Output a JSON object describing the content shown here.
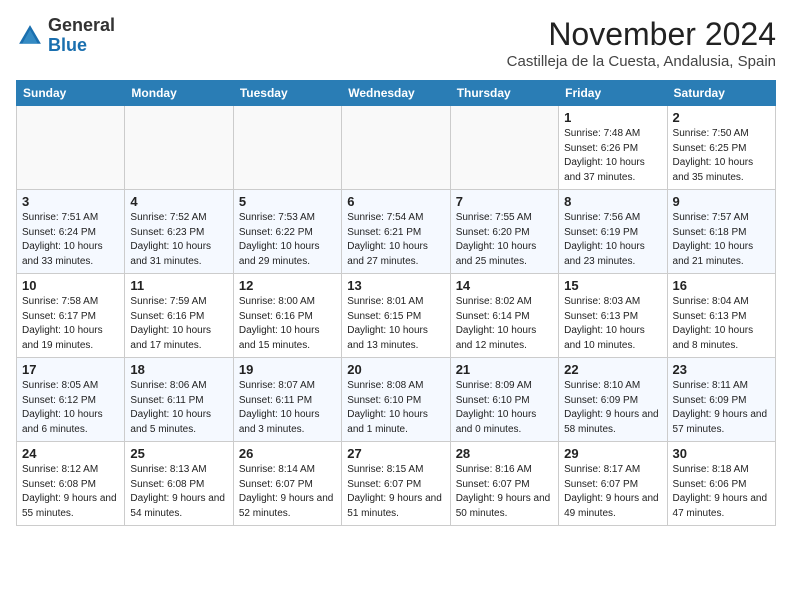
{
  "header": {
    "logo_general": "General",
    "logo_blue": "Blue",
    "month_year": "November 2024",
    "location": "Castilleja de la Cuesta, Andalusia, Spain"
  },
  "weekdays": [
    "Sunday",
    "Monday",
    "Tuesday",
    "Wednesday",
    "Thursday",
    "Friday",
    "Saturday"
  ],
  "weeks": [
    [
      {
        "day": "",
        "info": ""
      },
      {
        "day": "",
        "info": ""
      },
      {
        "day": "",
        "info": ""
      },
      {
        "day": "",
        "info": ""
      },
      {
        "day": "",
        "info": ""
      },
      {
        "day": "1",
        "info": "Sunrise: 7:48 AM\nSunset: 6:26 PM\nDaylight: 10 hours and 37 minutes."
      },
      {
        "day": "2",
        "info": "Sunrise: 7:50 AM\nSunset: 6:25 PM\nDaylight: 10 hours and 35 minutes."
      }
    ],
    [
      {
        "day": "3",
        "info": "Sunrise: 7:51 AM\nSunset: 6:24 PM\nDaylight: 10 hours and 33 minutes."
      },
      {
        "day": "4",
        "info": "Sunrise: 7:52 AM\nSunset: 6:23 PM\nDaylight: 10 hours and 31 minutes."
      },
      {
        "day": "5",
        "info": "Sunrise: 7:53 AM\nSunset: 6:22 PM\nDaylight: 10 hours and 29 minutes."
      },
      {
        "day": "6",
        "info": "Sunrise: 7:54 AM\nSunset: 6:21 PM\nDaylight: 10 hours and 27 minutes."
      },
      {
        "day": "7",
        "info": "Sunrise: 7:55 AM\nSunset: 6:20 PM\nDaylight: 10 hours and 25 minutes."
      },
      {
        "day": "8",
        "info": "Sunrise: 7:56 AM\nSunset: 6:19 PM\nDaylight: 10 hours and 23 minutes."
      },
      {
        "day": "9",
        "info": "Sunrise: 7:57 AM\nSunset: 6:18 PM\nDaylight: 10 hours and 21 minutes."
      }
    ],
    [
      {
        "day": "10",
        "info": "Sunrise: 7:58 AM\nSunset: 6:17 PM\nDaylight: 10 hours and 19 minutes."
      },
      {
        "day": "11",
        "info": "Sunrise: 7:59 AM\nSunset: 6:16 PM\nDaylight: 10 hours and 17 minutes."
      },
      {
        "day": "12",
        "info": "Sunrise: 8:00 AM\nSunset: 6:16 PM\nDaylight: 10 hours and 15 minutes."
      },
      {
        "day": "13",
        "info": "Sunrise: 8:01 AM\nSunset: 6:15 PM\nDaylight: 10 hours and 13 minutes."
      },
      {
        "day": "14",
        "info": "Sunrise: 8:02 AM\nSunset: 6:14 PM\nDaylight: 10 hours and 12 minutes."
      },
      {
        "day": "15",
        "info": "Sunrise: 8:03 AM\nSunset: 6:13 PM\nDaylight: 10 hours and 10 minutes."
      },
      {
        "day": "16",
        "info": "Sunrise: 8:04 AM\nSunset: 6:13 PM\nDaylight: 10 hours and 8 minutes."
      }
    ],
    [
      {
        "day": "17",
        "info": "Sunrise: 8:05 AM\nSunset: 6:12 PM\nDaylight: 10 hours and 6 minutes."
      },
      {
        "day": "18",
        "info": "Sunrise: 8:06 AM\nSunset: 6:11 PM\nDaylight: 10 hours and 5 minutes."
      },
      {
        "day": "19",
        "info": "Sunrise: 8:07 AM\nSunset: 6:11 PM\nDaylight: 10 hours and 3 minutes."
      },
      {
        "day": "20",
        "info": "Sunrise: 8:08 AM\nSunset: 6:10 PM\nDaylight: 10 hours and 1 minute."
      },
      {
        "day": "21",
        "info": "Sunrise: 8:09 AM\nSunset: 6:10 PM\nDaylight: 10 hours and 0 minutes."
      },
      {
        "day": "22",
        "info": "Sunrise: 8:10 AM\nSunset: 6:09 PM\nDaylight: 9 hours and 58 minutes."
      },
      {
        "day": "23",
        "info": "Sunrise: 8:11 AM\nSunset: 6:09 PM\nDaylight: 9 hours and 57 minutes."
      }
    ],
    [
      {
        "day": "24",
        "info": "Sunrise: 8:12 AM\nSunset: 6:08 PM\nDaylight: 9 hours and 55 minutes."
      },
      {
        "day": "25",
        "info": "Sunrise: 8:13 AM\nSunset: 6:08 PM\nDaylight: 9 hours and 54 minutes."
      },
      {
        "day": "26",
        "info": "Sunrise: 8:14 AM\nSunset: 6:07 PM\nDaylight: 9 hours and 52 minutes."
      },
      {
        "day": "27",
        "info": "Sunrise: 8:15 AM\nSunset: 6:07 PM\nDaylight: 9 hours and 51 minutes."
      },
      {
        "day": "28",
        "info": "Sunrise: 8:16 AM\nSunset: 6:07 PM\nDaylight: 9 hours and 50 minutes."
      },
      {
        "day": "29",
        "info": "Sunrise: 8:17 AM\nSunset: 6:07 PM\nDaylight: 9 hours and 49 minutes."
      },
      {
        "day": "30",
        "info": "Sunrise: 8:18 AM\nSunset: 6:06 PM\nDaylight: 9 hours and 47 minutes."
      }
    ]
  ]
}
